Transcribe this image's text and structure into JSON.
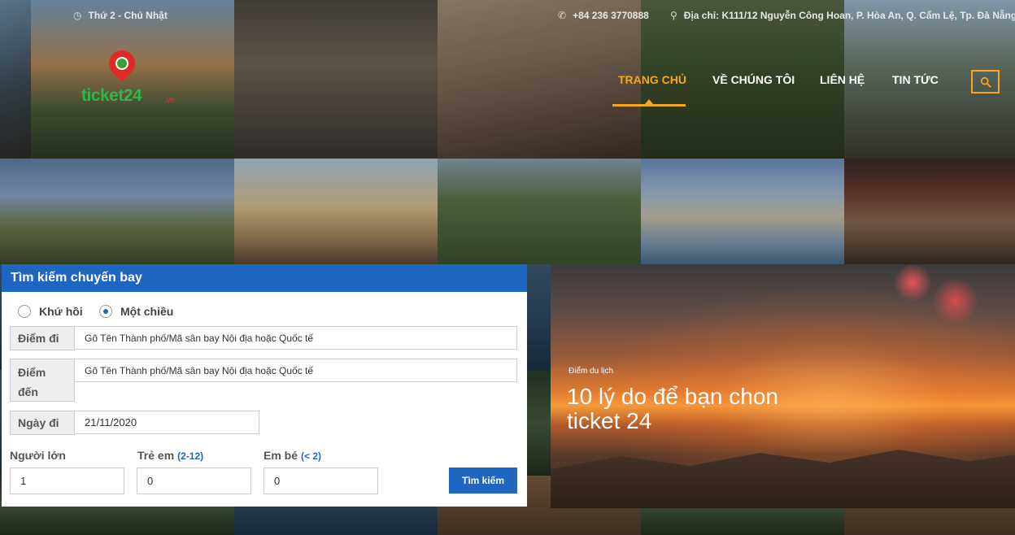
{
  "header": {
    "date_text": "Thứ 2 - Chủ Nhật",
    "phone_text": "+84 236 3770888",
    "address_text": "Địa chỉ: K111/12 Nguyễn Công Hoan, P. Hòa An, Q. Cẩm Lệ, Tp. Đà Nẵng.",
    "logo_text": "ticket24",
    "logo_suffix": ".vn"
  },
  "nav": {
    "items": [
      {
        "label": "TRANG CHỦ",
        "active": true
      },
      {
        "label": "VỀ CHÚNG TÔI",
        "active": false
      },
      {
        "label": "LIÊN HỆ",
        "active": false
      },
      {
        "label": "TIN TỨC",
        "active": false
      }
    ],
    "search_icon": "search-icon"
  },
  "flight_search": {
    "title": "Tìm kiếm chuyến bay",
    "trip_types": [
      {
        "label": "Khứ hồi",
        "checked": false
      },
      {
        "label": "Một chiều",
        "checked": true
      }
    ],
    "from_label": "Điểm đi",
    "from_value": "Gõ Tên Thành phố/Mã sân bay Nội địa hoặc Quốc tế",
    "to_label": "Điểm đến",
    "to_value": "Gõ Tên Thành phố/Mã sân bay Nội địa hoặc Quốc tế",
    "date_label": "Ngày đi",
    "date_value": "21/11/2020",
    "adults_label": "Người lớn",
    "adults_value": "1",
    "children_label": "Trẻ em",
    "children_range": "(2-12)",
    "children_value": "0",
    "infants_label": "Em bé",
    "infants_range": "(< 2)",
    "infants_value": "0",
    "submit_label": "Tìm kiếm"
  },
  "promo": {
    "category": "Điểm du lịch",
    "title": "10 lý do để bạn chon ticket 24"
  },
  "colors": {
    "accent": "#f5a623",
    "primary": "#1e66c2",
    "logo_green": "#2fb54a",
    "logo_red": "#e02a2a"
  }
}
